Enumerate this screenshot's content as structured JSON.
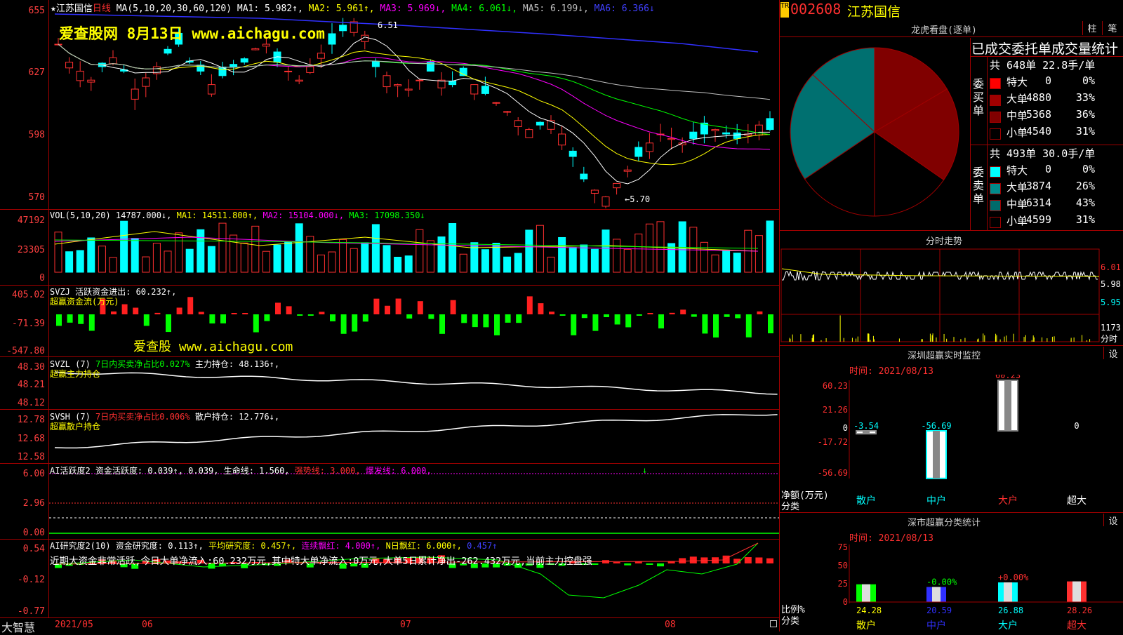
{
  "header": {
    "star": "★",
    "stock_name": "江苏国信",
    "period": "日线",
    "ma_text": "MA(5,10,20,30,60,120)",
    "ma1": "MA1: 5.982↑,",
    "ma2": "MA2: 5.961↑,",
    "ma3": "MA3: 5.969↓,",
    "ma4": "MA4: 6.061↓,",
    "ma5": "MA5: 6.199↓,",
    "ma6": "MA6: 6.366↓",
    "watermark1": "爱查股网  8月13日  www.aichagu.com",
    "high_label": "6.51",
    "low_label": "←5.70"
  },
  "main_axis": [
    "655",
    "627",
    "598",
    "570"
  ],
  "vol": {
    "title": "VOL(5,10,20) 14787.000↓,",
    "ma1": "MA1: 14511.800↑,",
    "ma2": "MA2: 15104.000↓,",
    "ma3": "MA3: 17098.350↓",
    "axis": [
      "47192",
      "23305",
      "0"
    ]
  },
  "svzj": {
    "title": "SVZJ  活跃资金进出: 60.232↑,",
    "subtitle": "超赢资金流(万元)",
    "watermark": "爱查股 www.aichagu.com",
    "axis": [
      "405.02",
      "-71.39",
      "-547.80"
    ]
  },
  "svzl": {
    "title": "SVZL (7)",
    "ratio": "7日内买卖净占比0.027%",
    "hold": "主力持仓: 48.136↑,",
    "subtitle": "超赢主力持仓",
    "axis": [
      "48.30",
      "48.21",
      "48.12"
    ]
  },
  "svsh": {
    "title": "SVSH (7)",
    "ratio": "7日内买卖净占比0.006%",
    "hold": "散户持仓: 12.776↓,",
    "subtitle": "超赢散户持仓",
    "axis": [
      "12.78",
      "12.68",
      "12.58"
    ]
  },
  "ai_active": {
    "title": "AI活跃度2 资金活跃度: 0.039↑, 0.039, 生命线: 1.560,",
    "strong": "强势线: 3.000,",
    "burst": "爆发线: 6.000,",
    "axis": [
      "6.00",
      "2.96",
      "0.00"
    ]
  },
  "ai_research": {
    "title": "AI研究度2(10) 资金研究度: 0.113↑,",
    "avg": "平均研究度: 0.457↑,",
    "cont": "连续飘红: 4.000↑,",
    "nday": "N日飘红: 6.000↑,",
    "last": "0.457↑",
    "desc": "近期大资金非常活跃,今日大单净流入:60.232万元,其中特大单净流入:0万元,大单5日累计净出-262.432万元,当前主力控盘强",
    "axis": [
      "0.54",
      "-0.12",
      "-0.77"
    ]
  },
  "bottom": {
    "logo": "大智慧",
    "dates": [
      "2021/05",
      "06",
      "07",
      "08"
    ]
  },
  "right": {
    "code": "002608",
    "name": "江苏国信",
    "btn1": "柱",
    "btn2": "笔",
    "lhb_title": "龙虎看盘(逐单)",
    "stat_title": "已成交委托单成交量统计",
    "buy_label": "委买单",
    "sell_label": "委卖单",
    "buy_total": "共 648单 22.8手/单",
    "sell_total": "共 493单 30.0手/单",
    "buy_rows": [
      {
        "name": "特大",
        "vol": "0",
        "pct": "0%",
        "color": "#ff0000"
      },
      {
        "name": "大单",
        "vol": "4880",
        "pct": "33%",
        "color": "#a00000"
      },
      {
        "name": "中单",
        "vol": "5368",
        "pct": "36%",
        "color": "#800000"
      },
      {
        "name": "小单",
        "vol": "4540",
        "pct": "31%",
        "color": "#000000"
      }
    ],
    "sell_rows": [
      {
        "name": "特大",
        "vol": "0",
        "pct": "0%",
        "color": "#00ffff"
      },
      {
        "name": "大单",
        "vol": "3874",
        "pct": "26%",
        "color": "#008b8b"
      },
      {
        "name": "中单",
        "vol": "6314",
        "pct": "43%",
        "color": "#006b6b"
      },
      {
        "name": "小单",
        "vol": "4599",
        "pct": "31%",
        "color": "#000000"
      }
    ],
    "fs_title": "分时走势",
    "fs_axis": [
      "6.01",
      "5.98",
      "5.95"
    ],
    "fs_vol": "1173",
    "fs_vol_label": "分时",
    "sz_title": "深圳超赢实时监控",
    "sz_btn": "设",
    "sz_time": "时间: 2021/08/13",
    "sz_axis": [
      "60.23",
      "21.26",
      "0",
      "-17.72",
      "-56.69"
    ],
    "sz_values": [
      "-3.54",
      "-56.69",
      "60.23",
      "0"
    ],
    "sz_ylabel": "净额(万元)",
    "sz_xlabel": "分类",
    "cats": [
      "散户",
      "中户",
      "大户",
      "超大"
    ],
    "cls_title": "深市超赢分类统计",
    "cls_btn": "设",
    "cls_time": "时间: 2021/08/13",
    "cls_axis": [
      "75",
      "50",
      "25",
      "0"
    ],
    "cls_values": [
      "24.28",
      "20.59",
      "26.88",
      "28.26"
    ],
    "cls_changes": [
      "",
      "-0.00%",
      "+0.00%",
      ""
    ],
    "cls_ylabel": "比例%",
    "cls_xlabel": "分类"
  }
}
